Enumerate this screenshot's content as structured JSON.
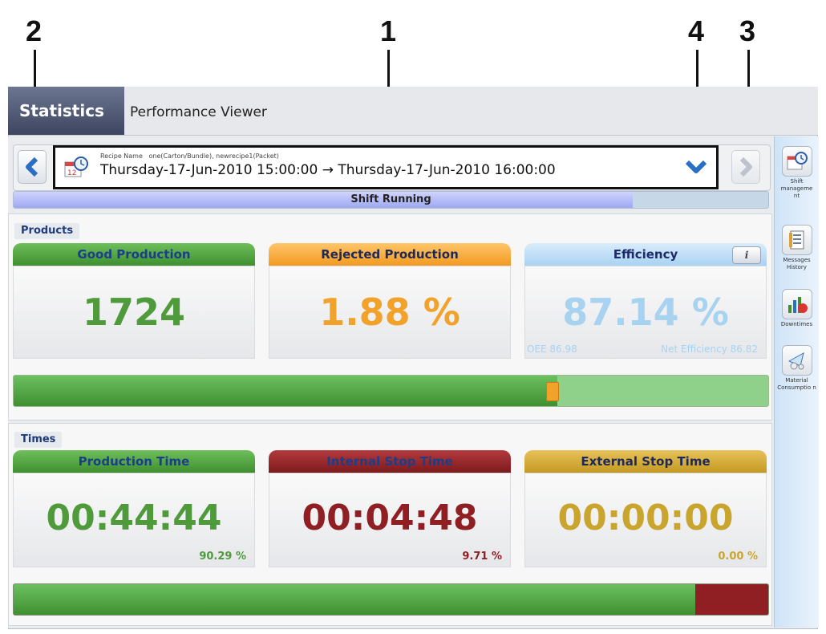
{
  "callouts": [
    "2",
    "1",
    "4",
    "3"
  ],
  "header": {
    "title": "Statistics",
    "subtitle": "Performance Viewer"
  },
  "selector": {
    "recipe_label": "Recipe Name",
    "recipe_value": "one(Carton/Bundle), newrecipe1(Packet)",
    "start": "Thursday-17-Jun-2010 15:00:00",
    "arrow": "→",
    "end": "Thursday-17-Jun-2010 16:00:00"
  },
  "shift_status": {
    "label": "Shift Running",
    "progress": 0.82
  },
  "products": {
    "label": "Products",
    "good": {
      "title": "Good Production",
      "value": "1724"
    },
    "rejected": {
      "title": "Rejected Production",
      "value": "1.88 %"
    },
    "efficiency": {
      "title": "Efficiency",
      "value": "87.14 %",
      "oee": "OEE 86.98",
      "net": "Net Efficiency 86.82",
      "info_icon": "i"
    },
    "bar_fraction": 0.72
  },
  "times": {
    "label": "Times",
    "production": {
      "title": "Production Time",
      "value": "00:44:44",
      "pct": "90.29 %"
    },
    "internal": {
      "title": "Internal Stop Time",
      "value": "00:04:48",
      "pct": "9.71 %"
    },
    "external": {
      "title": "External Stop Time",
      "value": "00:00:00",
      "pct": "0.00 %"
    },
    "bar_fraction": 0.9029
  },
  "sidebar": {
    "items": [
      {
        "label": "Shift manageme nt",
        "icon": "calendar-clock-icon"
      },
      {
        "label": "Messages History",
        "icon": "messages-icon"
      },
      {
        "label": "Downtimes",
        "icon": "downtimes-icon"
      },
      {
        "label": "Material Consumptio n",
        "icon": "material-icon"
      }
    ]
  },
  "colors": {
    "green": "#4f9a3b",
    "orange": "#f2a12a",
    "blue_faint": "#a8d3f0",
    "dark_red": "#8f1f22",
    "gold": "#c9a52e"
  }
}
